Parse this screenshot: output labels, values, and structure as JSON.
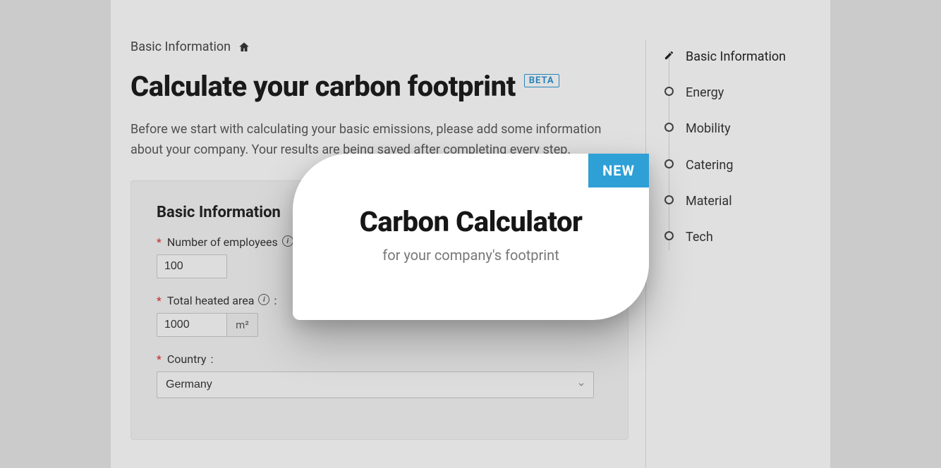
{
  "breadcrumb": {
    "label": "Basic Information"
  },
  "title": "Calculate your carbon footprint",
  "beta_badge": "BETA",
  "intro": "Before we start with calculating your basic emissions, please add some information about your company. Your results are being saved after completing every step.",
  "form": {
    "section_title": "Basic Information",
    "fields": {
      "employees": {
        "label": "Number of employees",
        "value": "100"
      },
      "heated_area": {
        "label": "Total heated area",
        "value": "1000",
        "unit": "m²"
      },
      "country": {
        "label": "Country",
        "value": "Germany"
      }
    }
  },
  "steps": [
    {
      "label": "Basic Information",
      "current": true
    },
    {
      "label": "Energy",
      "current": false
    },
    {
      "label": "Mobility",
      "current": false
    },
    {
      "label": "Catering",
      "current": false
    },
    {
      "label": "Material",
      "current": false
    },
    {
      "label": "Tech",
      "current": false
    }
  ],
  "overlay": {
    "tag": "NEW",
    "title": "Carbon Calculator",
    "subtitle": "for your company's footprint"
  },
  "colors": {
    "accent": "#2ea0d6",
    "beta_border": "#2a8cc6"
  }
}
